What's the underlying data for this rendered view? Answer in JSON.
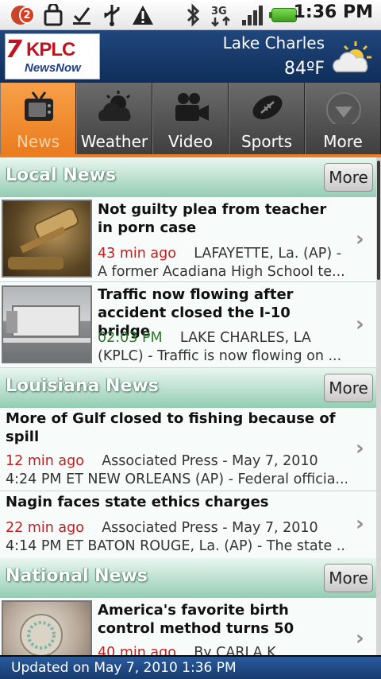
{
  "status_bar": {
    "notification_count": "2",
    "time": "1:36 PM",
    "network": "3G",
    "icons": [
      "notification-icon",
      "bag-icon",
      "checklist-icon",
      "usb-icon",
      "warning-icon",
      "bluetooth-icon",
      "3g-icon",
      "signal-icon",
      "battery-icon"
    ]
  },
  "header": {
    "logo_text": "KPLC",
    "logo_prefix": "7",
    "logo_sub": "NewsNow",
    "city": "Lake Charles",
    "temperature": "84ºF",
    "weather_icon": "partly-sunny-icon"
  },
  "tabs": [
    {
      "label": "News",
      "icon": "tv-icon",
      "active": true
    },
    {
      "label": "Weather",
      "icon": "cloud-sun-icon",
      "active": false
    },
    {
      "label": "Video",
      "icon": "video-camera-icon",
      "active": false
    },
    {
      "label": "Sports",
      "icon": "football-icon",
      "active": false
    },
    {
      "label": "More",
      "icon": "chevron-down-icon",
      "active": false
    }
  ],
  "sections": {
    "local": {
      "title": "Local News",
      "more": "More",
      "items": [
        {
          "headline": "Not guilty plea from teacher in porn case",
          "time": "43 min ago",
          "meta1": "LAFAYETTE, La. (AP) -",
          "meta2": "A former Acadiana High School te..."
        },
        {
          "headline": "Traffic now flowing after accident closed the I-10 bridge",
          "time": "02:03 PM",
          "meta1": "LAKE CHARLES, LA",
          "meta2": "(KPLC) - Traffic is now flowing on ..."
        }
      ]
    },
    "louisiana": {
      "title": "Louisiana News",
      "more": "More",
      "items": [
        {
          "headline": "More of Gulf closed to fishing because of spill",
          "time": "12 min ago",
          "meta1": "Associated Press - May 7, 2010",
          "meta2": "4:24 PM ET NEW ORLEANS (AP) - Federal officia..."
        },
        {
          "headline": "Nagin faces state ethics charges",
          "time": "22 min ago",
          "meta1": "Associated Press - May 7, 2010",
          "meta2": "4:14 PM ET BATON ROUGE, La. (AP) - The state ..."
        }
      ]
    },
    "national": {
      "title": "National News",
      "more": "More",
      "items": [
        {
          "headline": "America's favorite birth control method turns 50",
          "time": "40 min ago",
          "meta1": "By CARLA K"
        }
      ]
    }
  },
  "footer": {
    "updated": "Updated on May 7, 2010 1:36 PM"
  }
}
